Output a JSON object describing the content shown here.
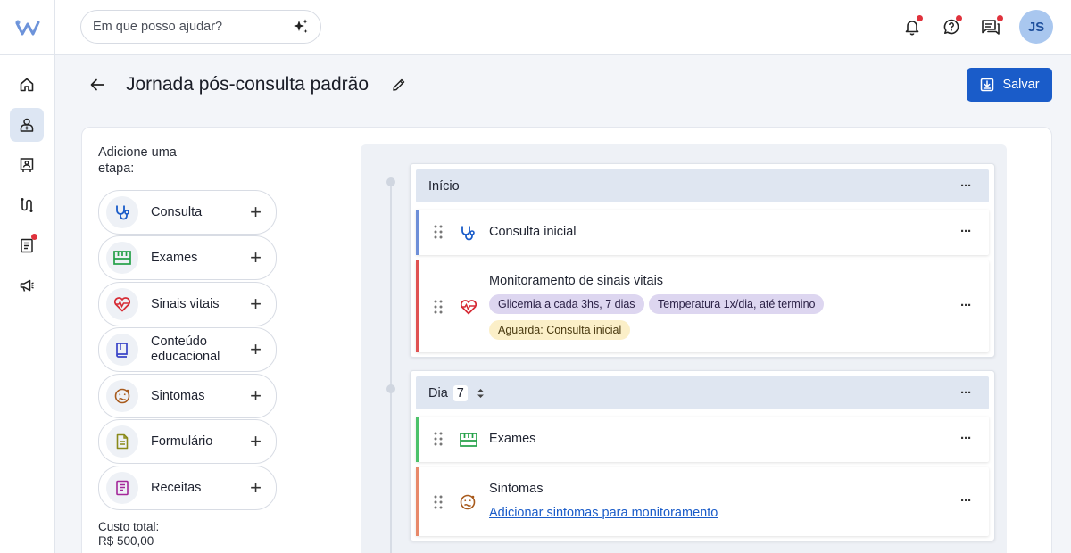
{
  "search": {
    "placeholder": "Em que posso ajudar?"
  },
  "user": {
    "initials": "JS"
  },
  "header": {
    "title": "Jornada pós-consulta padrão",
    "save_label": "Salvar"
  },
  "palette": {
    "title": "Adicione uma etapa:",
    "items": [
      {
        "label": "Consulta",
        "icon": "stethoscope-icon"
      },
      {
        "label": "Exames",
        "icon": "lab-exams-icon"
      },
      {
        "label": "Sinais vitais",
        "icon": "heart-pulse-icon"
      },
      {
        "label": "Conteúdo educacional",
        "icon": "book-icon"
      },
      {
        "label": "Sintomas",
        "icon": "sick-face-icon"
      },
      {
        "label": "Formulário",
        "icon": "form-icon"
      },
      {
        "label": "Receitas",
        "icon": "prescription-icon"
      }
    ],
    "cost_label": "Custo total:",
    "cost_value": "R$ 500,00"
  },
  "journey": {
    "groups": [
      {
        "head": "Início",
        "steps": [
          {
            "title": "Consulta inicial",
            "color": "#6e8fd8"
          },
          {
            "title": "Monitoramento de sinais vitais",
            "color": "#e05252",
            "chips": [
              "Glicemia a cada 3hs, 7 dias",
              "Temperatura 1x/dia, até termino"
            ],
            "waiting": "Aguarda: Consulta inicial"
          }
        ]
      },
      {
        "head": "Dia",
        "day": "7",
        "steps": [
          {
            "title": "Exames",
            "color": "#4cc26a"
          },
          {
            "title": "Sintomas",
            "color": "#e8896a",
            "link": "Adicionar sintomas para monitoramento"
          }
        ]
      }
    ]
  },
  "colors": {
    "primary": "#1a5cc9",
    "accent_red": "#e0323c"
  }
}
